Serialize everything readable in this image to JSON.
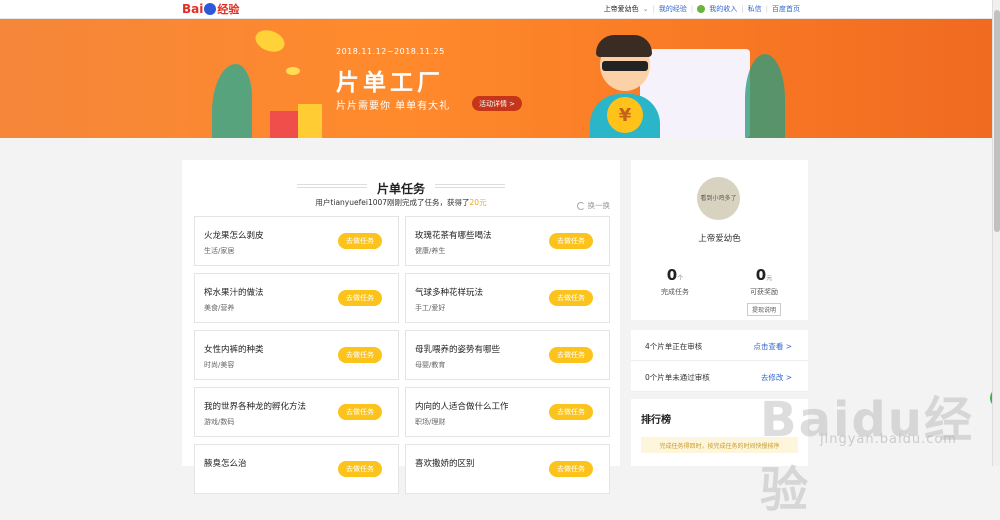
{
  "top": {
    "logo_text": "Bai",
    "logo_suffix": "经验",
    "user": "上帝爱幼色",
    "links": [
      "我的经验",
      "我的收入",
      "私信",
      "百度首页"
    ]
  },
  "banner": {
    "date": "2018.11.12~2018.11.25",
    "title": "片单工厂",
    "subtitle": "片片需要你 单单有大礼",
    "detail_button": "活动详情 >",
    "coin_symbol": "¥"
  },
  "tasks": {
    "title": "片单任务",
    "notice_prefix": "用户tianyuefei1007刚刚完成了任务，获得了",
    "notice_reward": "20元",
    "refresh": "换一换",
    "go_label": "去做任务",
    "items": [
      {
        "title": "火龙果怎么剥皮",
        "category": "生活/家居"
      },
      {
        "title": "玫瑰花茶有哪些喝法",
        "category": "健康/养生"
      },
      {
        "title": "榨水果汁的做法",
        "category": "美食/营养"
      },
      {
        "title": "气球多种花样玩法",
        "category": "手工/爱好"
      },
      {
        "title": "女性内裤的种类",
        "category": "时尚/美容"
      },
      {
        "title": "母乳喂养的姿势有哪些",
        "category": "母婴/教育"
      },
      {
        "title": "我的世界各种龙的孵化方法",
        "category": "游戏/数码"
      },
      {
        "title": "内向的人适合做什么工作",
        "category": "职场/理财"
      },
      {
        "title": "腋臭怎么治",
        "category": ""
      },
      {
        "title": "喜欢撒娇的区别",
        "category": ""
      }
    ]
  },
  "profile": {
    "avatar_text": "看到小鸡多了",
    "name": "上帝爱幼色",
    "completed_num": "0",
    "completed_unit": "个",
    "completed_label": "完成任务",
    "reward_num": "0",
    "reward_unit": "元",
    "reward_label": "可获奖励",
    "withdraw": "提现说明"
  },
  "audit": [
    {
      "text": "4个片单正在审核",
      "link": "点击查看 >"
    },
    {
      "text": "0个片单未通过审核",
      "link": "去修改 >"
    }
  ],
  "rank": {
    "title": "排行榜",
    "hint": "完成任务得回时，按完成任务的时间快慢排序"
  },
  "watermark": {
    "main": "Baidu经验",
    "sub": "jingyan.baidu.com"
  }
}
